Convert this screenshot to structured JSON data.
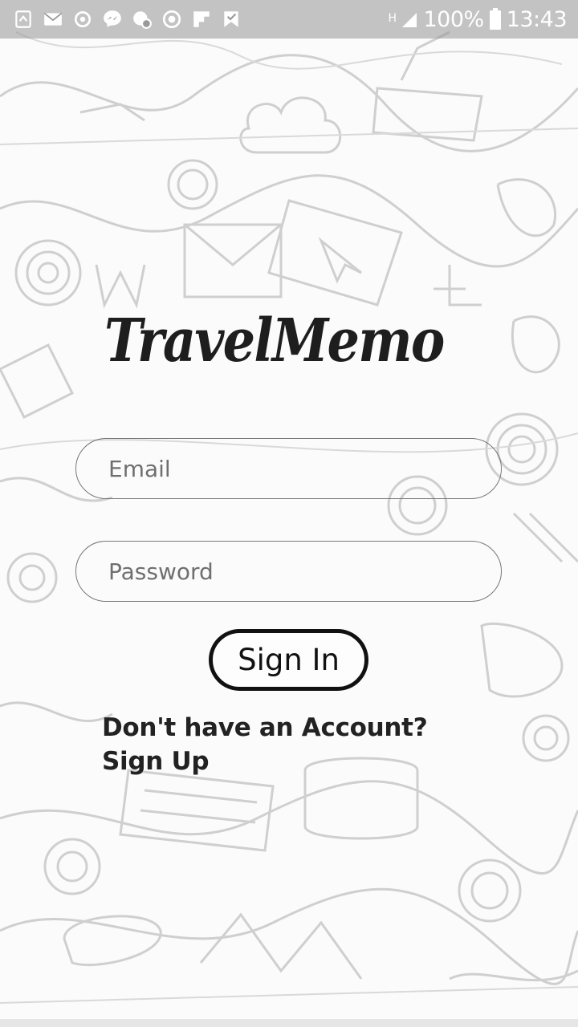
{
  "status_bar": {
    "battery_percent": "100%",
    "time": "13:43",
    "network_type": "H",
    "notification_icons": [
      "app-icon",
      "mail-icon",
      "sync-icon",
      "messenger-icon",
      "update-icon",
      "timer-icon",
      "flipboard-icon",
      "checklist-icon"
    ]
  },
  "app": {
    "title": "TravelMemo"
  },
  "login": {
    "email_placeholder": "Email",
    "password_placeholder": "Password",
    "sign_in_label": "Sign In",
    "signup_prompt": "Don't have an Account? Sign Up"
  },
  "colors": {
    "text": "#1e1e1e",
    "field_border": "#777777",
    "button_border": "#111111",
    "doodle_stroke": "#c8c8c8"
  }
}
